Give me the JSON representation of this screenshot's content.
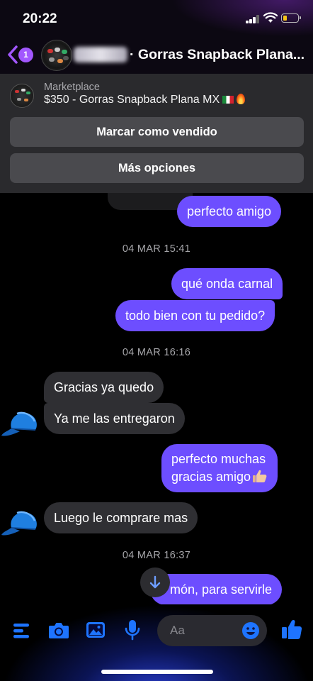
{
  "status_bar": {
    "time": "20:22"
  },
  "header": {
    "unread_count": "1",
    "title": "· Gorras Snapback Plana..."
  },
  "marketplace": {
    "label": "Marketplace",
    "listing": "$350 - Gorras Snapback Plana MX",
    "mark_sold_button": "Marcar como vendido",
    "more_options_button": "Más opciones"
  },
  "messages": [
    {
      "text": "perfecto amigo",
      "direction": "outgoing"
    },
    {
      "timestamp": "04 MAR 15:41"
    },
    {
      "text": "qué onda carnal",
      "direction": "outgoing"
    },
    {
      "text": "todo bien con tu pedido?",
      "direction": "outgoing"
    },
    {
      "timestamp": "04 MAR 16:16"
    },
    {
      "text": "Gracias ya quedo",
      "direction": "incoming"
    },
    {
      "text": "Ya me las entregaron",
      "direction": "incoming"
    },
    {
      "text_line1": "perfecto muchas",
      "text_line2": "gracias amigo",
      "direction": "outgoing"
    },
    {
      "text": "Luego le comprare mas",
      "direction": "incoming"
    },
    {
      "timestamp": "04 MAR 16:37"
    },
    {
      "text": "món, para servirle",
      "direction": "outgoing"
    }
  ],
  "composer": {
    "placeholder": "Aa"
  },
  "colors": {
    "outgoing_bubble": "#6d4eff",
    "incoming_bubble": "#2f2f33",
    "accent_blue": "#1e74ff",
    "badge": "#a257ff"
  },
  "icons": [
    "back-chevron-icon",
    "signal-icon",
    "wifi-icon",
    "battery-icon",
    "menu-icon",
    "camera-icon",
    "gallery-icon",
    "microphone-icon",
    "emoji-icon",
    "like-icon",
    "arrow-down-icon",
    "cap-icon",
    "thumbs-up-emoji-icon",
    "mexico-flag-icon",
    "fire-emoji-icon"
  ]
}
